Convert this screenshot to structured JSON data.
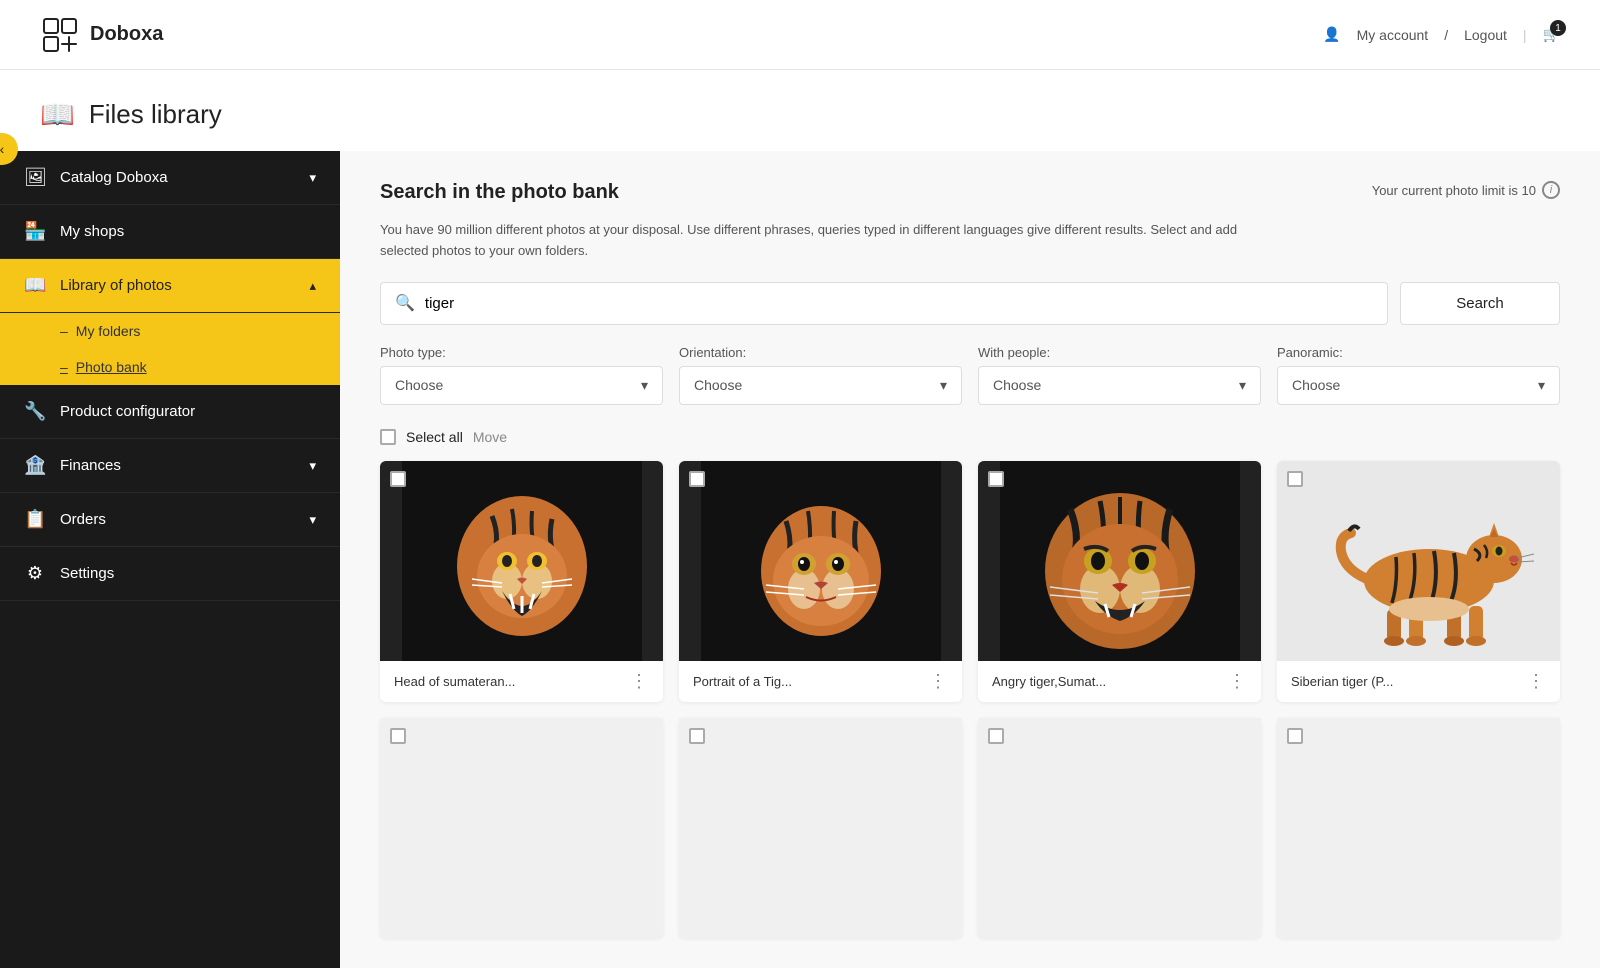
{
  "app": {
    "name": "Doboxa"
  },
  "header": {
    "account_label": "My account",
    "logout_label": "Logout",
    "divider": "/",
    "cart_count": "1"
  },
  "page": {
    "title": "Files library",
    "title_icon": "📖"
  },
  "sidebar": {
    "back_title": "Go back",
    "items": [
      {
        "id": "catalog",
        "icon": "🖼",
        "label": "Catalog Doboxa",
        "has_chevron": true,
        "active": false
      },
      {
        "id": "my-shops",
        "icon": "🏪",
        "label": "My shops",
        "has_chevron": false,
        "active": false
      },
      {
        "id": "library",
        "icon": "📖",
        "label": "Library of photos",
        "has_chevron": true,
        "active": true
      },
      {
        "id": "product-configurator",
        "icon": "🔧",
        "label": "Product configurator",
        "has_chevron": false,
        "active": false
      },
      {
        "id": "finances",
        "icon": "🏦",
        "label": "Finances",
        "has_chevron": true,
        "active": false
      },
      {
        "id": "orders",
        "icon": "📋",
        "label": "Orders",
        "has_chevron": true,
        "active": false
      },
      {
        "id": "settings",
        "icon": "⚙",
        "label": "Settings",
        "has_chevron": false,
        "active": false
      }
    ],
    "sub_items": [
      {
        "id": "my-folders",
        "label": "My folders",
        "active": false
      },
      {
        "id": "photo-bank",
        "label": "Photo bank",
        "active": true
      }
    ]
  },
  "photo_bank": {
    "title": "Search in the photo bank",
    "photo_limit_text": "Your current photo limit is 10",
    "description": "You have 90 million different photos at your disposal. Use different phrases, queries typed in different languages give different results. Select and add selected photos to your own folders.",
    "search_placeholder": "tiger",
    "search_button_label": "Search",
    "filters": [
      {
        "id": "photo-type",
        "label": "Photo type:",
        "placeholder": "Choose"
      },
      {
        "id": "orientation",
        "label": "Orientation:",
        "placeholder": "Choose"
      },
      {
        "id": "with-people",
        "label": "With people:",
        "placeholder": "Choose"
      },
      {
        "id": "panoramic",
        "label": "Panoramic:",
        "placeholder": "Choose"
      }
    ],
    "select_all_label": "Select all",
    "move_label": "Move",
    "photos": [
      {
        "id": "photo-1",
        "name": "Head of sumateran...",
        "bg": "#111",
        "type": "roaring"
      },
      {
        "id": "photo-2",
        "name": "Portrait of a Tig...",
        "bg": "#111",
        "type": "portrait"
      },
      {
        "id": "photo-3",
        "name": "Angry tiger,Sumat...",
        "bg": "#111",
        "type": "angry"
      },
      {
        "id": "photo-4",
        "name": "Siberian tiger (P...",
        "bg": "#f0f0f0",
        "type": "walking"
      }
    ]
  }
}
